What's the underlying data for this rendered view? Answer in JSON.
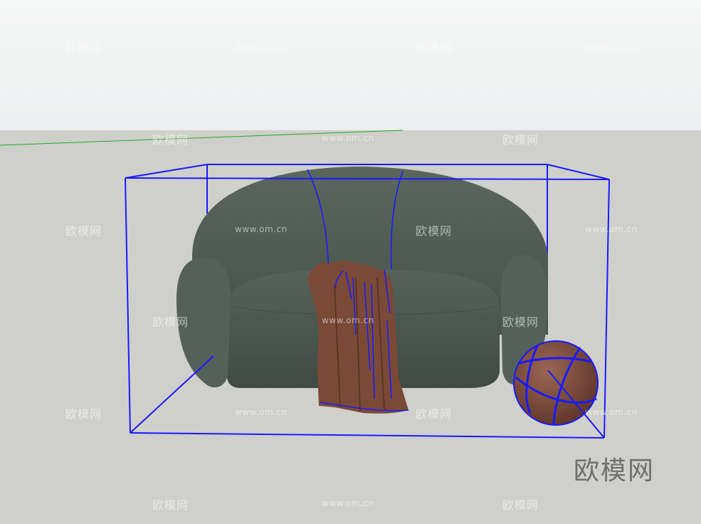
{
  "viewport": {
    "sky_color": "#eef0f1",
    "ground_color": "#cfd0cb",
    "selection_color": "#1a1aff",
    "axis_color": "#22aa22"
  },
  "objects": {
    "sofa_color": "#4d5a52",
    "throw_color": "#7a4a36",
    "ball_color": "#7b4a3a"
  },
  "watermark": {
    "brand_text": "欧模网",
    "repeat_text": "欧模网",
    "repeat_url": "www.om.cn"
  }
}
